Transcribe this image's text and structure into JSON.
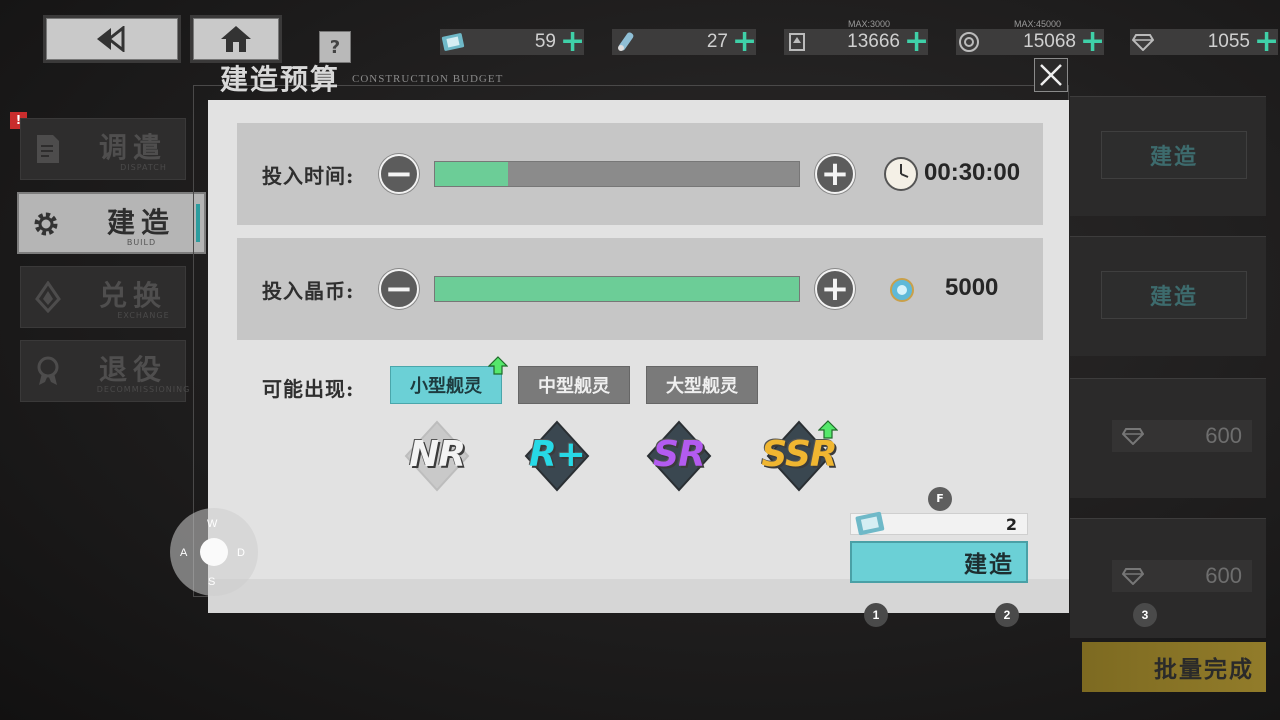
{
  "topbar": {
    "help_label": "?",
    "resources": [
      {
        "name": "construction-ticket",
        "value": "59",
        "max": ""
      },
      {
        "name": "rocket-material",
        "value": "27",
        "max": ""
      },
      {
        "name": "badge-currency",
        "value": "13666",
        "max": "MAX:3000"
      },
      {
        "name": "crystal-coin",
        "value": "15068",
        "max": "MAX:45000"
      },
      {
        "name": "diamond",
        "value": "1055",
        "max": ""
      }
    ],
    "plus_label": "+"
  },
  "sidebar": {
    "alert": "!",
    "items": [
      {
        "label": "调遣",
        "sub": "DISPATCH",
        "icon": "document-icon",
        "active": false
      },
      {
        "label": "建造",
        "sub": "BUILD",
        "icon": "gear-icon",
        "active": true
      },
      {
        "label": "兑换",
        "sub": "EXCHANGE",
        "icon": "crystal-icon",
        "active": false
      },
      {
        "label": "退役",
        "sub": "DECOMMISSIONING",
        "icon": "medal-icon",
        "active": false
      }
    ]
  },
  "background": {
    "build_button_1": "建造",
    "build_button_2": "建造",
    "cost_1": "600",
    "cost_2": "600",
    "batch_complete": "批量完成"
  },
  "dialog": {
    "title": "建造预算",
    "subtitle": "CONSTRUCTION BUDGET",
    "time_row": {
      "label": "投入时间:",
      "value": "00:30:00",
      "fill_fraction": 0.2
    },
    "coin_row": {
      "label": "投入晶币:",
      "value": "5000",
      "fill_fraction": 1.0
    },
    "minus_label": "−",
    "plus_label": "+",
    "may_appear_label": "可能出现:",
    "ship_types": [
      {
        "label": "小型舰灵",
        "selected": true,
        "boosted": true
      },
      {
        "label": "中型舰灵",
        "selected": false,
        "boosted": false
      },
      {
        "label": "大型舰灵",
        "selected": false,
        "boosted": false
      }
    ],
    "rarities": [
      {
        "label": "NR",
        "color": "#f3f3f3",
        "boosted": false
      },
      {
        "label": "R+",
        "color": "#27d9e6",
        "boosted": false
      },
      {
        "label": "SR",
        "color": "#b35bf0",
        "boosted": false
      },
      {
        "label": "SSR",
        "color": "#f0b631",
        "boosted": true
      }
    ],
    "ticket_cost": "2",
    "build_label": "建造",
    "interact_key": "F"
  },
  "controls": {
    "joystick_keys": {
      "up": "W",
      "left": "A",
      "right": "D",
      "down": "S"
    },
    "hotkeys": [
      "1",
      "2",
      "3"
    ]
  },
  "colors": {
    "accent_cyan": "#6bd0d6",
    "fill_green": "#6ccd97",
    "plus_green": "#3fd0a8",
    "gold": "#927c2a"
  }
}
